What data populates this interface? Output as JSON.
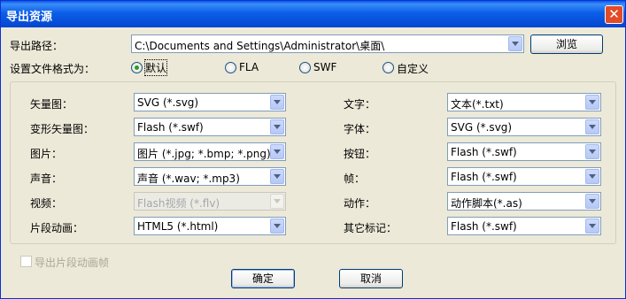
{
  "window": {
    "title": "导出资源",
    "close_glyph": "✕"
  },
  "path": {
    "label": "导出路径：",
    "value": "C:\\Documents and Settings\\Administrator\\桌面\\",
    "browse_label": "浏览"
  },
  "format": {
    "label": "设置文件格式为：",
    "options": [
      {
        "label": "默认",
        "checked": true
      },
      {
        "label": "FLA",
        "checked": false
      },
      {
        "label": "SWF",
        "checked": false
      },
      {
        "label": "自定义",
        "checked": false
      }
    ]
  },
  "left_fields": [
    {
      "label": "矢量图：",
      "value": "SVG (*.svg)",
      "enabled": true
    },
    {
      "label": "变形矢量图：",
      "value": "Flash (*.swf)",
      "enabled": true
    },
    {
      "label": "图片：",
      "value": "图片 (*.jpg; *.bmp; *.png)",
      "enabled": true
    },
    {
      "label": "声音：",
      "value": "声音 (*.wav; *.mp3)",
      "enabled": true
    },
    {
      "label": "视频：",
      "value": "Flash视频 (*.flv)",
      "enabled": false
    },
    {
      "label": "片段动画：",
      "value": "HTML5 (*.html)",
      "enabled": true
    }
  ],
  "right_fields": [
    {
      "label": "文字：",
      "value": "文本(*.txt)",
      "enabled": true
    },
    {
      "label": "字体：",
      "value": "SVG (*.svg)",
      "enabled": true
    },
    {
      "label": "按钮：",
      "value": "Flash (*.swf)",
      "enabled": true
    },
    {
      "label": "帧：",
      "value": "Flash (*.swf)",
      "enabled": true
    },
    {
      "label": "动作：",
      "value": "动作脚本(*.as)",
      "enabled": true
    },
    {
      "label": "其它标记：",
      "value": "Flash (*.swf)",
      "enabled": true
    }
  ],
  "export_frames": {
    "label": "导出片段动画帧",
    "checked": false,
    "enabled": false
  },
  "buttons": {
    "ok": "确定",
    "cancel": "取消"
  }
}
